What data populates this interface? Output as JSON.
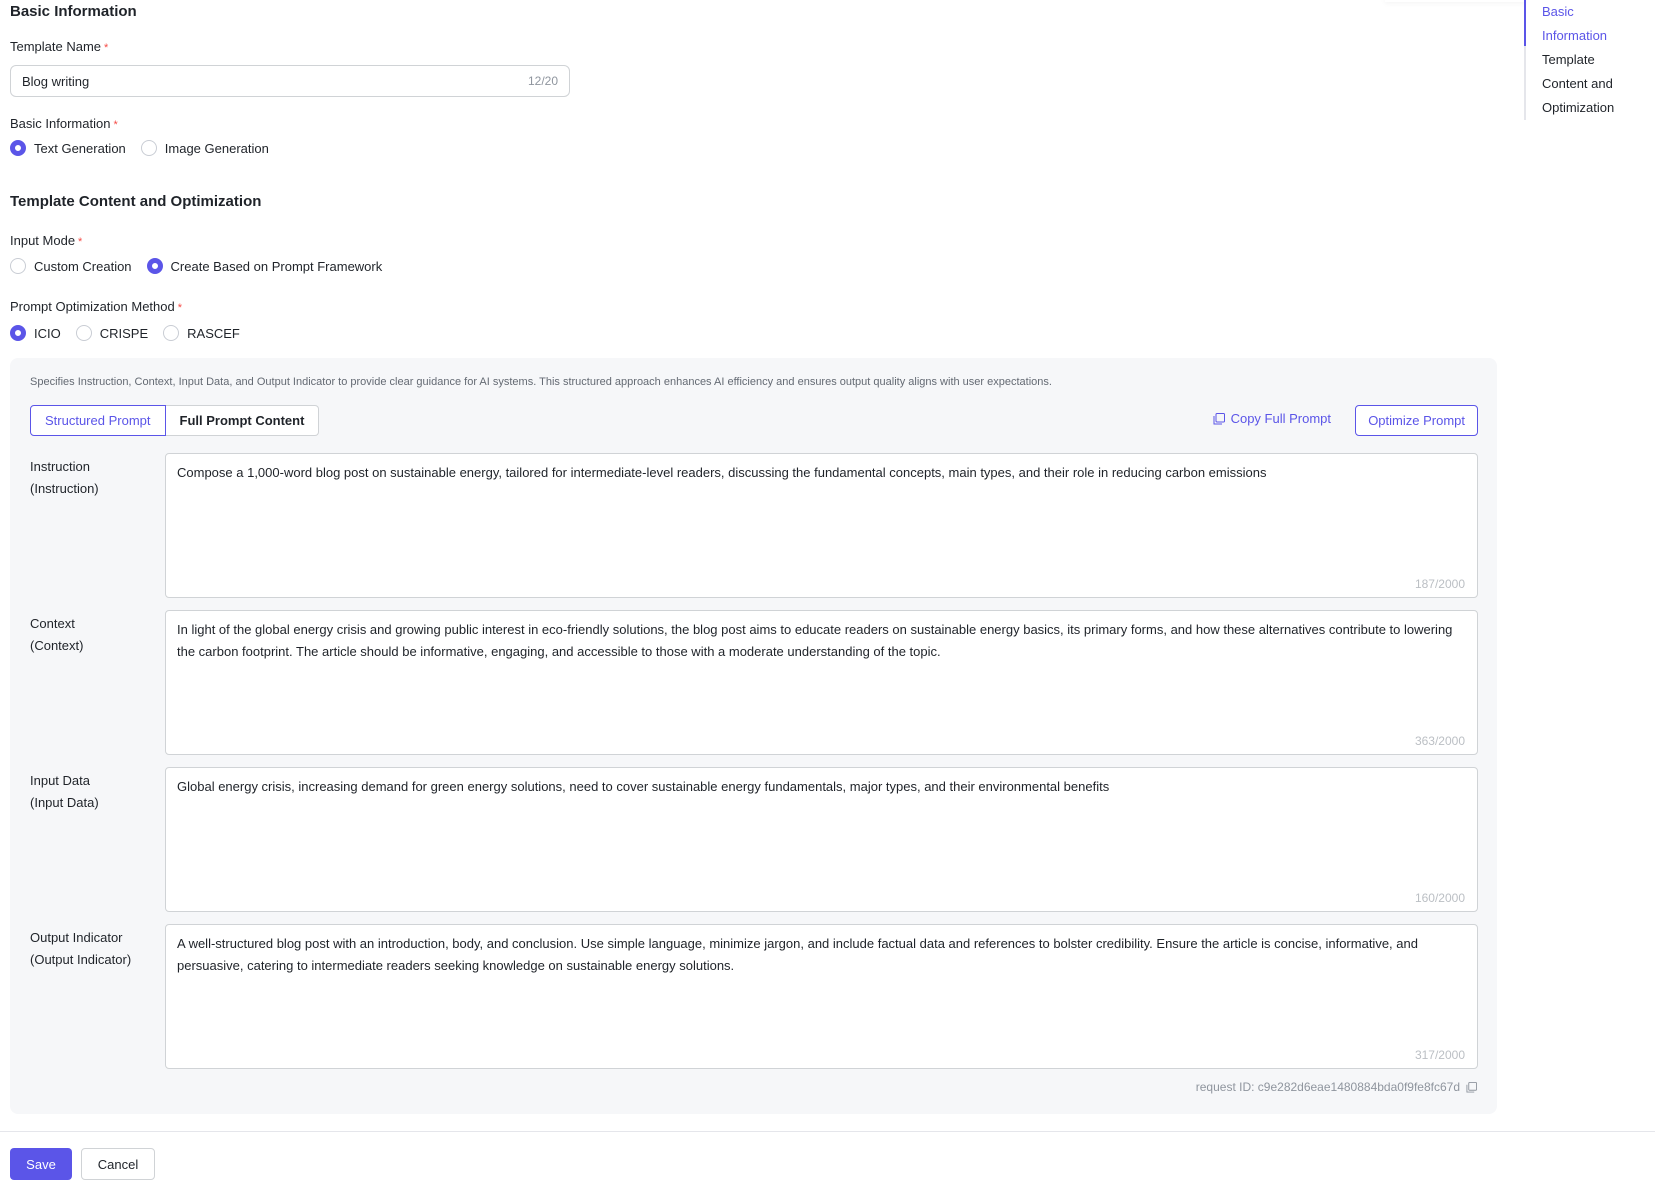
{
  "basic": {
    "title": "Basic Information",
    "template_name_label": "Template Name",
    "template_name_value": "Blog writing",
    "template_name_count": "12/20",
    "type_label": "Basic Information",
    "type_options": [
      "Text Generation",
      "Image Generation"
    ],
    "type_selected": "Text Generation"
  },
  "content": {
    "title": "Template Content and Optimization",
    "input_mode_label": "Input Mode",
    "input_mode_options": [
      "Custom Creation",
      "Create Based on Prompt Framework"
    ],
    "input_mode_selected": "Create Based on Prompt Framework",
    "method_label": "Prompt Optimization Method",
    "method_options": [
      "ICIO",
      "CRISPE",
      "RASCEF"
    ],
    "method_selected": "ICIO"
  },
  "panel": {
    "description": "Specifies Instruction, Context, Input Data, and Output Indicator to provide clear guidance for AI systems. This structured approach enhances AI efficiency and ensures output quality aligns with user expectations.",
    "tab_structured": "Structured Prompt",
    "tab_full": "Full Prompt Content",
    "copy_label": "Copy Full Prompt",
    "optimize_label": "Optimize Prompt",
    "fields": [
      {
        "label_line1": "Instruction",
        "label_line2": "(Instruction)",
        "text": "Compose a 1,000-word blog post on sustainable energy, tailored for intermediate-level readers, discussing the fundamental concepts, main types, and their role in reducing carbon emissions",
        "count": "187/2000"
      },
      {
        "label_line1": "Context",
        "label_line2": "(Context)",
        "text": "In light of the global energy crisis and growing public interest in eco-friendly solutions, the blog post aims to educate readers on sustainable energy basics, its primary forms, and how these alternatives contribute to lowering the carbon footprint. The article should be informative, engaging, and accessible to those with a moderate understanding of the topic.",
        "count": "363/2000"
      },
      {
        "label_line1": "Input Data",
        "label_line2": "(Input Data)",
        "text": "Global energy crisis, increasing demand for green energy solutions, need to cover sustainable energy fundamentals, major types, and their environmental benefits",
        "count": "160/2000"
      },
      {
        "label_line1": "Output Indicator",
        "label_line2": "(Output Indicator)",
        "text": "A well-structured blog post with an introduction, body, and conclusion. Use simple language, minimize jargon, and include factual data and references to bolster credibility. Ensure the article is concise, informative, and persuasive, catering to intermediate readers seeking knowledge on sustainable energy solutions.",
        "count": "317/2000"
      }
    ],
    "request_id": "request ID: c9e282d6eae1480884bda0f9fe8fc67d"
  },
  "footer": {
    "save_label": "Save",
    "cancel_label": "Cancel"
  },
  "anchor": {
    "items": [
      "Basic Information",
      "Template Content and Optimization"
    ],
    "active": "Basic Information"
  },
  "colors": {
    "accent": "#5b55e8",
    "required": "#f54a45"
  }
}
